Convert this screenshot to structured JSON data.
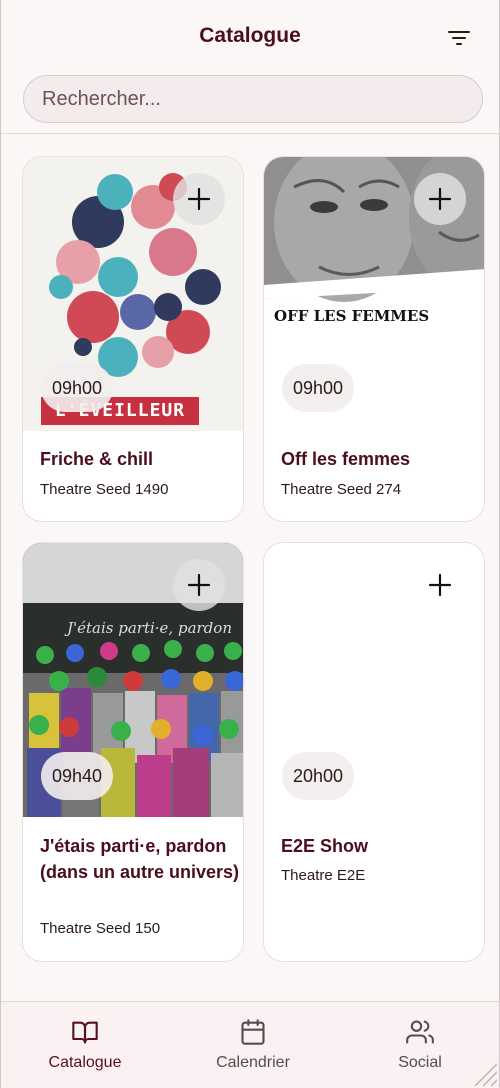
{
  "header": {
    "title": "Catalogue",
    "filter_icon": "filter-lines-icon"
  },
  "search": {
    "placeholder": "Rechercher..."
  },
  "cards": [
    {
      "time": "09h00",
      "title": "Friche & chill",
      "venue": "Theatre Seed 1490",
      "image_text": "L'ÉVEILLEUR"
    },
    {
      "time": "09h00",
      "title": "Off les femmes",
      "venue": "Theatre Seed 274",
      "image_text": "OFF LES FEMMES"
    },
    {
      "time": "09h40",
      "title": "J'étais parti·e, pardon (dans un autre univers)",
      "venue": "Theatre Seed 150",
      "image_text": "J'étais parti·e, pardon"
    },
    {
      "time": "20h00",
      "title": "E2E Show",
      "venue": "Theatre E2E"
    }
  ],
  "nav": [
    {
      "label": "Catalogue",
      "icon": "book-icon",
      "active": true
    },
    {
      "label": "Calendrier",
      "icon": "calendar-icon",
      "active": false
    },
    {
      "label": "Social",
      "icon": "users-icon",
      "active": false
    }
  ],
  "colors": {
    "accent": "#5a0f20",
    "background": "#fbf7f7",
    "card": "#ffffff"
  }
}
